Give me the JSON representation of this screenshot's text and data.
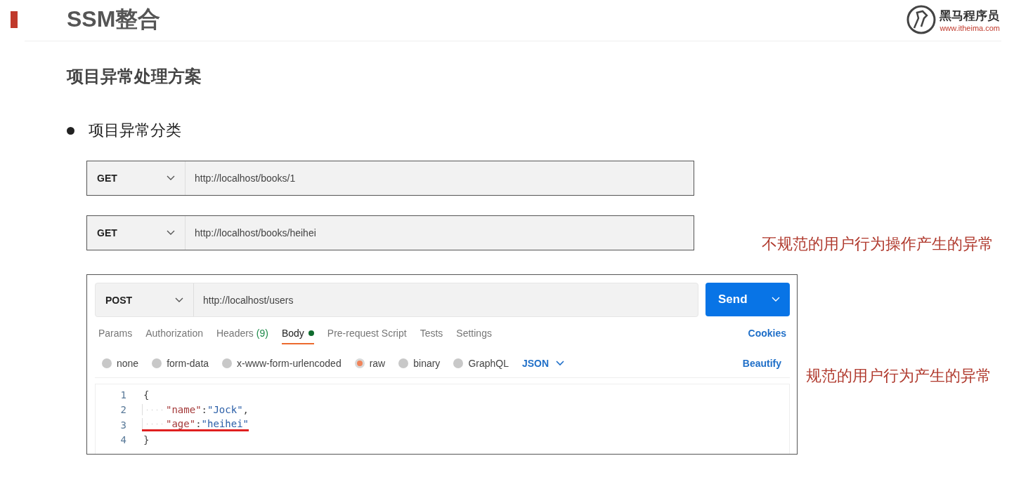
{
  "header": {
    "title": "SSM整合",
    "logo_name": "黑马程序员",
    "logo_url": "www.itheima.com"
  },
  "subtitle": "项目异常处理方案",
  "bullets": [
    "项目异常分类"
  ],
  "requests": [
    {
      "method": "GET",
      "url": "http://localhost/books/1"
    },
    {
      "method": "GET",
      "url": "http://localhost/books/heihei",
      "note": "不规范的用户行为操作产生的异常"
    }
  ],
  "postman": {
    "method": "POST",
    "url": "http://localhost/users",
    "send": "Send",
    "note": "规范的用户行为产生的异常",
    "tabs": [
      {
        "label": "Params",
        "selected": false
      },
      {
        "label": "Authorization",
        "selected": false
      },
      {
        "label": "Headers",
        "count": "(9)",
        "selected": false
      },
      {
        "label": "Body",
        "dot": true,
        "selected": true
      },
      {
        "label": "Pre-request Script",
        "selected": false
      },
      {
        "label": "Tests",
        "selected": false
      },
      {
        "label": "Settings",
        "selected": false
      }
    ],
    "cookies": "Cookies",
    "body_types": [
      {
        "label": "none",
        "selected": false
      },
      {
        "label": "form-data",
        "selected": false
      },
      {
        "label": "x-www-form-urlencoded",
        "selected": false
      },
      {
        "label": "raw",
        "selected": true
      },
      {
        "label": "binary",
        "selected": false
      },
      {
        "label": "GraphQL",
        "selected": false
      }
    ],
    "format": "JSON",
    "beautify": "Beautify",
    "code": [
      {
        "number": "1",
        "indented": false,
        "underlined": false,
        "tokens": [
          {
            "kind": "punct",
            "text": "{"
          }
        ]
      },
      {
        "number": "2",
        "indented": true,
        "underlined": false,
        "tokens": [
          {
            "kind": "key",
            "text": "\"name\""
          },
          {
            "kind": "punct",
            "text": ":"
          },
          {
            "kind": "string",
            "text": "\"Jock\""
          },
          {
            "kind": "punct",
            "text": ","
          }
        ]
      },
      {
        "number": "3",
        "indented": true,
        "underlined": true,
        "tokens": [
          {
            "kind": "key",
            "text": "\"age\""
          },
          {
            "kind": "punct",
            "text": ":"
          },
          {
            "kind": "string",
            "text": "\"heihei\""
          }
        ]
      },
      {
        "number": "4",
        "indented": false,
        "underlined": false,
        "tokens": [
          {
            "kind": "punct",
            "text": "}"
          }
        ]
      }
    ]
  }
}
